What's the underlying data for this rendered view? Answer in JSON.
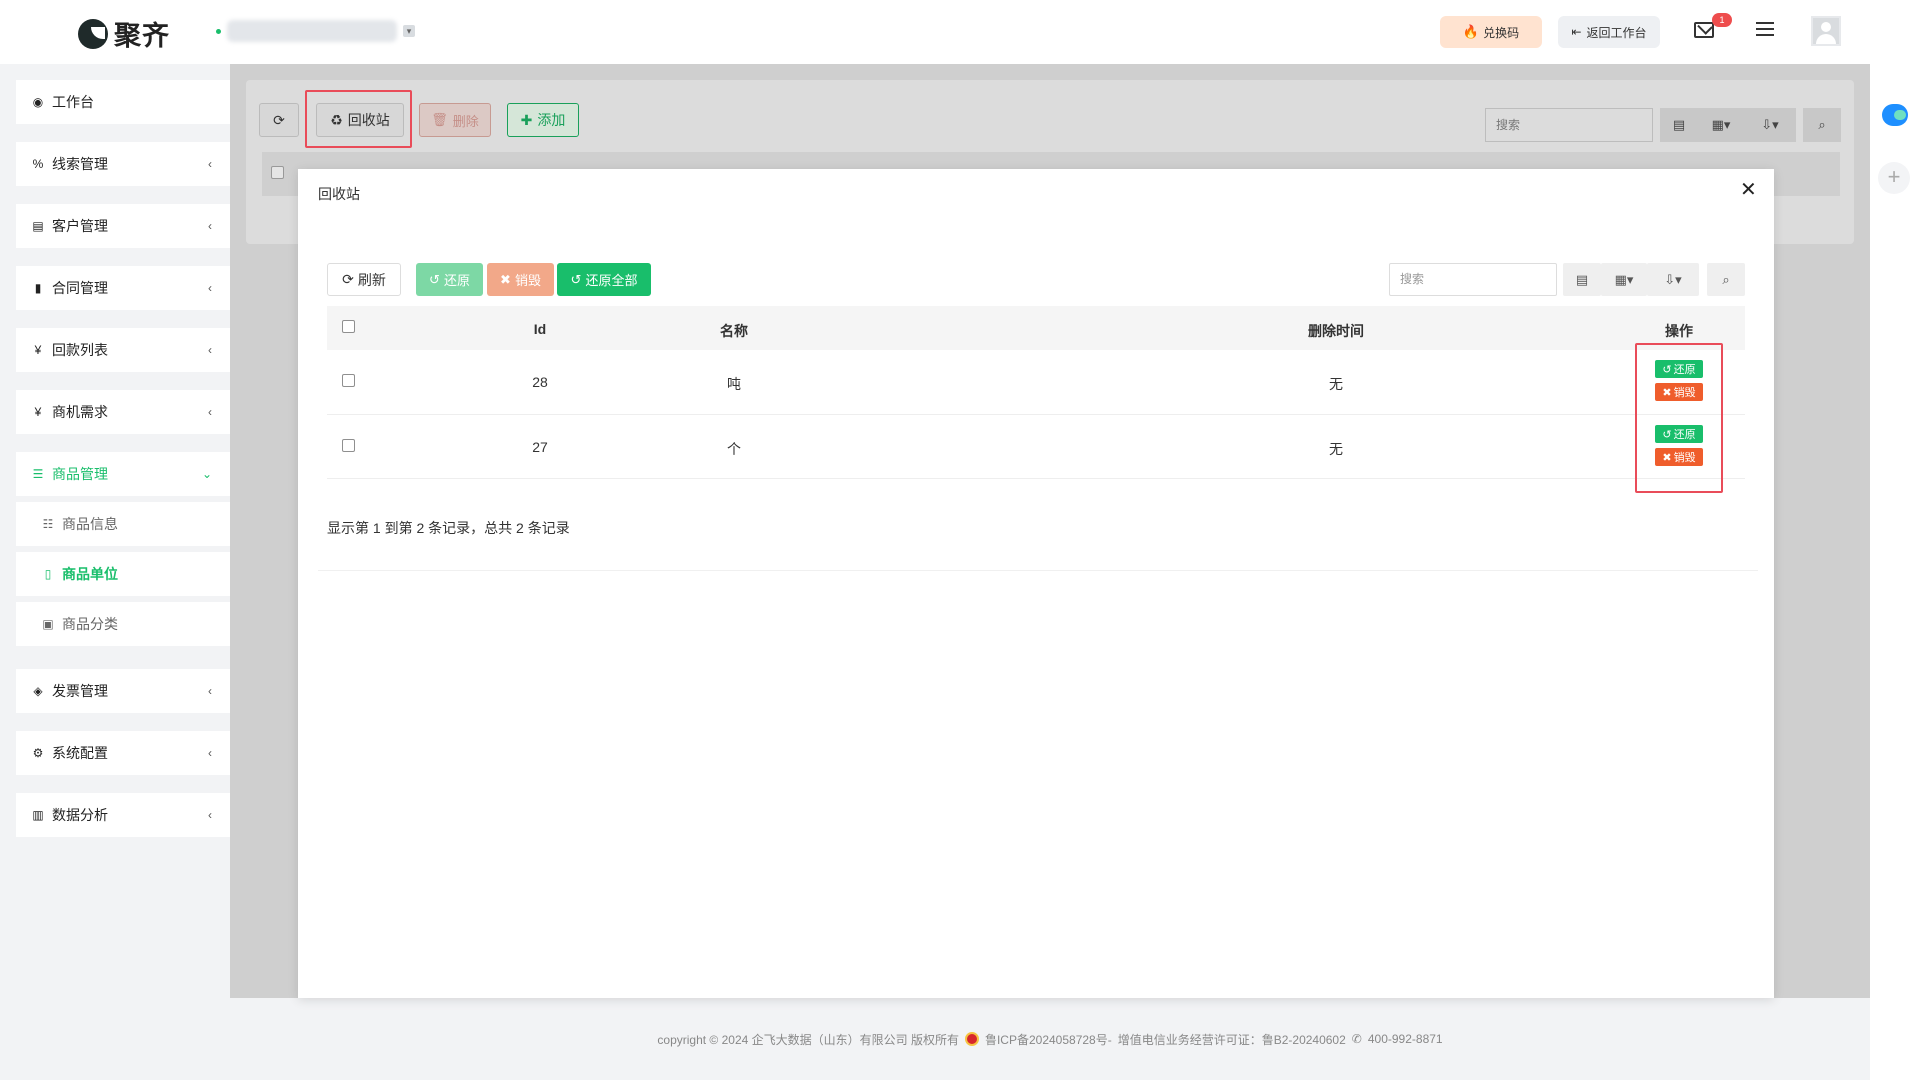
{
  "header": {
    "brand": "聚齐",
    "org_caret": "▾",
    "redeem_label": "兑换码",
    "back_label": "返回工作台",
    "mail_badge": "1"
  },
  "sidebar": {
    "items": [
      {
        "label": "工作台",
        "icon": "dashboard-icon"
      },
      {
        "label": "线索管理",
        "icon": "link-icon"
      },
      {
        "label": "客户管理",
        "icon": "id-card-icon"
      },
      {
        "label": "合同管理",
        "icon": "bookmark-icon"
      },
      {
        "label": "回款列表",
        "icon": "yen-icon"
      },
      {
        "label": "商机需求",
        "icon": "yen-icon"
      },
      {
        "label": "商品管理",
        "icon": "list-icon"
      },
      {
        "label": "发票管理",
        "icon": "tag-icon"
      },
      {
        "label": "系统配置",
        "icon": "gears-icon"
      },
      {
        "label": "数据分析",
        "icon": "bar-chart-icon"
      }
    ],
    "sub_items": [
      {
        "label": "商品信息",
        "icon": "list-indent-icon"
      },
      {
        "label": "商品单位",
        "icon": "bookmark-icon"
      },
      {
        "label": "商品分类",
        "icon": "calendar-icon"
      }
    ]
  },
  "page_toolbar": {
    "recycle_label": "回收站",
    "delete_label": "删除",
    "add_label": "添加",
    "search_placeholder": "搜索"
  },
  "modal": {
    "title": "回收站",
    "close": "✕",
    "toolbar": {
      "refresh_label": "刷新",
      "restore_label": "还原",
      "destroy_label": "销毁",
      "restore_all_label": "还原全部",
      "search_placeholder": "搜索"
    },
    "columns": [
      "Id",
      "名称",
      "删除时间",
      "操作"
    ],
    "rows": [
      {
        "id": "28",
        "name": "吨",
        "deleted_time": "无"
      },
      {
        "id": "27",
        "name": "个",
        "deleted_time": "无"
      }
    ],
    "row_actions": {
      "restore": "还原",
      "destroy": "销毁"
    },
    "pager_info": "显示第 1 到第 2 条记录，总共 2 条记录"
  },
  "footer": {
    "copyright": "copyright © 2024 企飞大数据（山东）有限公司 版权所有",
    "icp": "鲁ICP备2024058728号-",
    "license": "增值电信业务经营许可证：鲁B2-20240602",
    "phone": "400-992-8871"
  },
  "colors": {
    "accent": "#19be6b",
    "danger": "#ef5d2c",
    "highlight": "#e94c59"
  }
}
